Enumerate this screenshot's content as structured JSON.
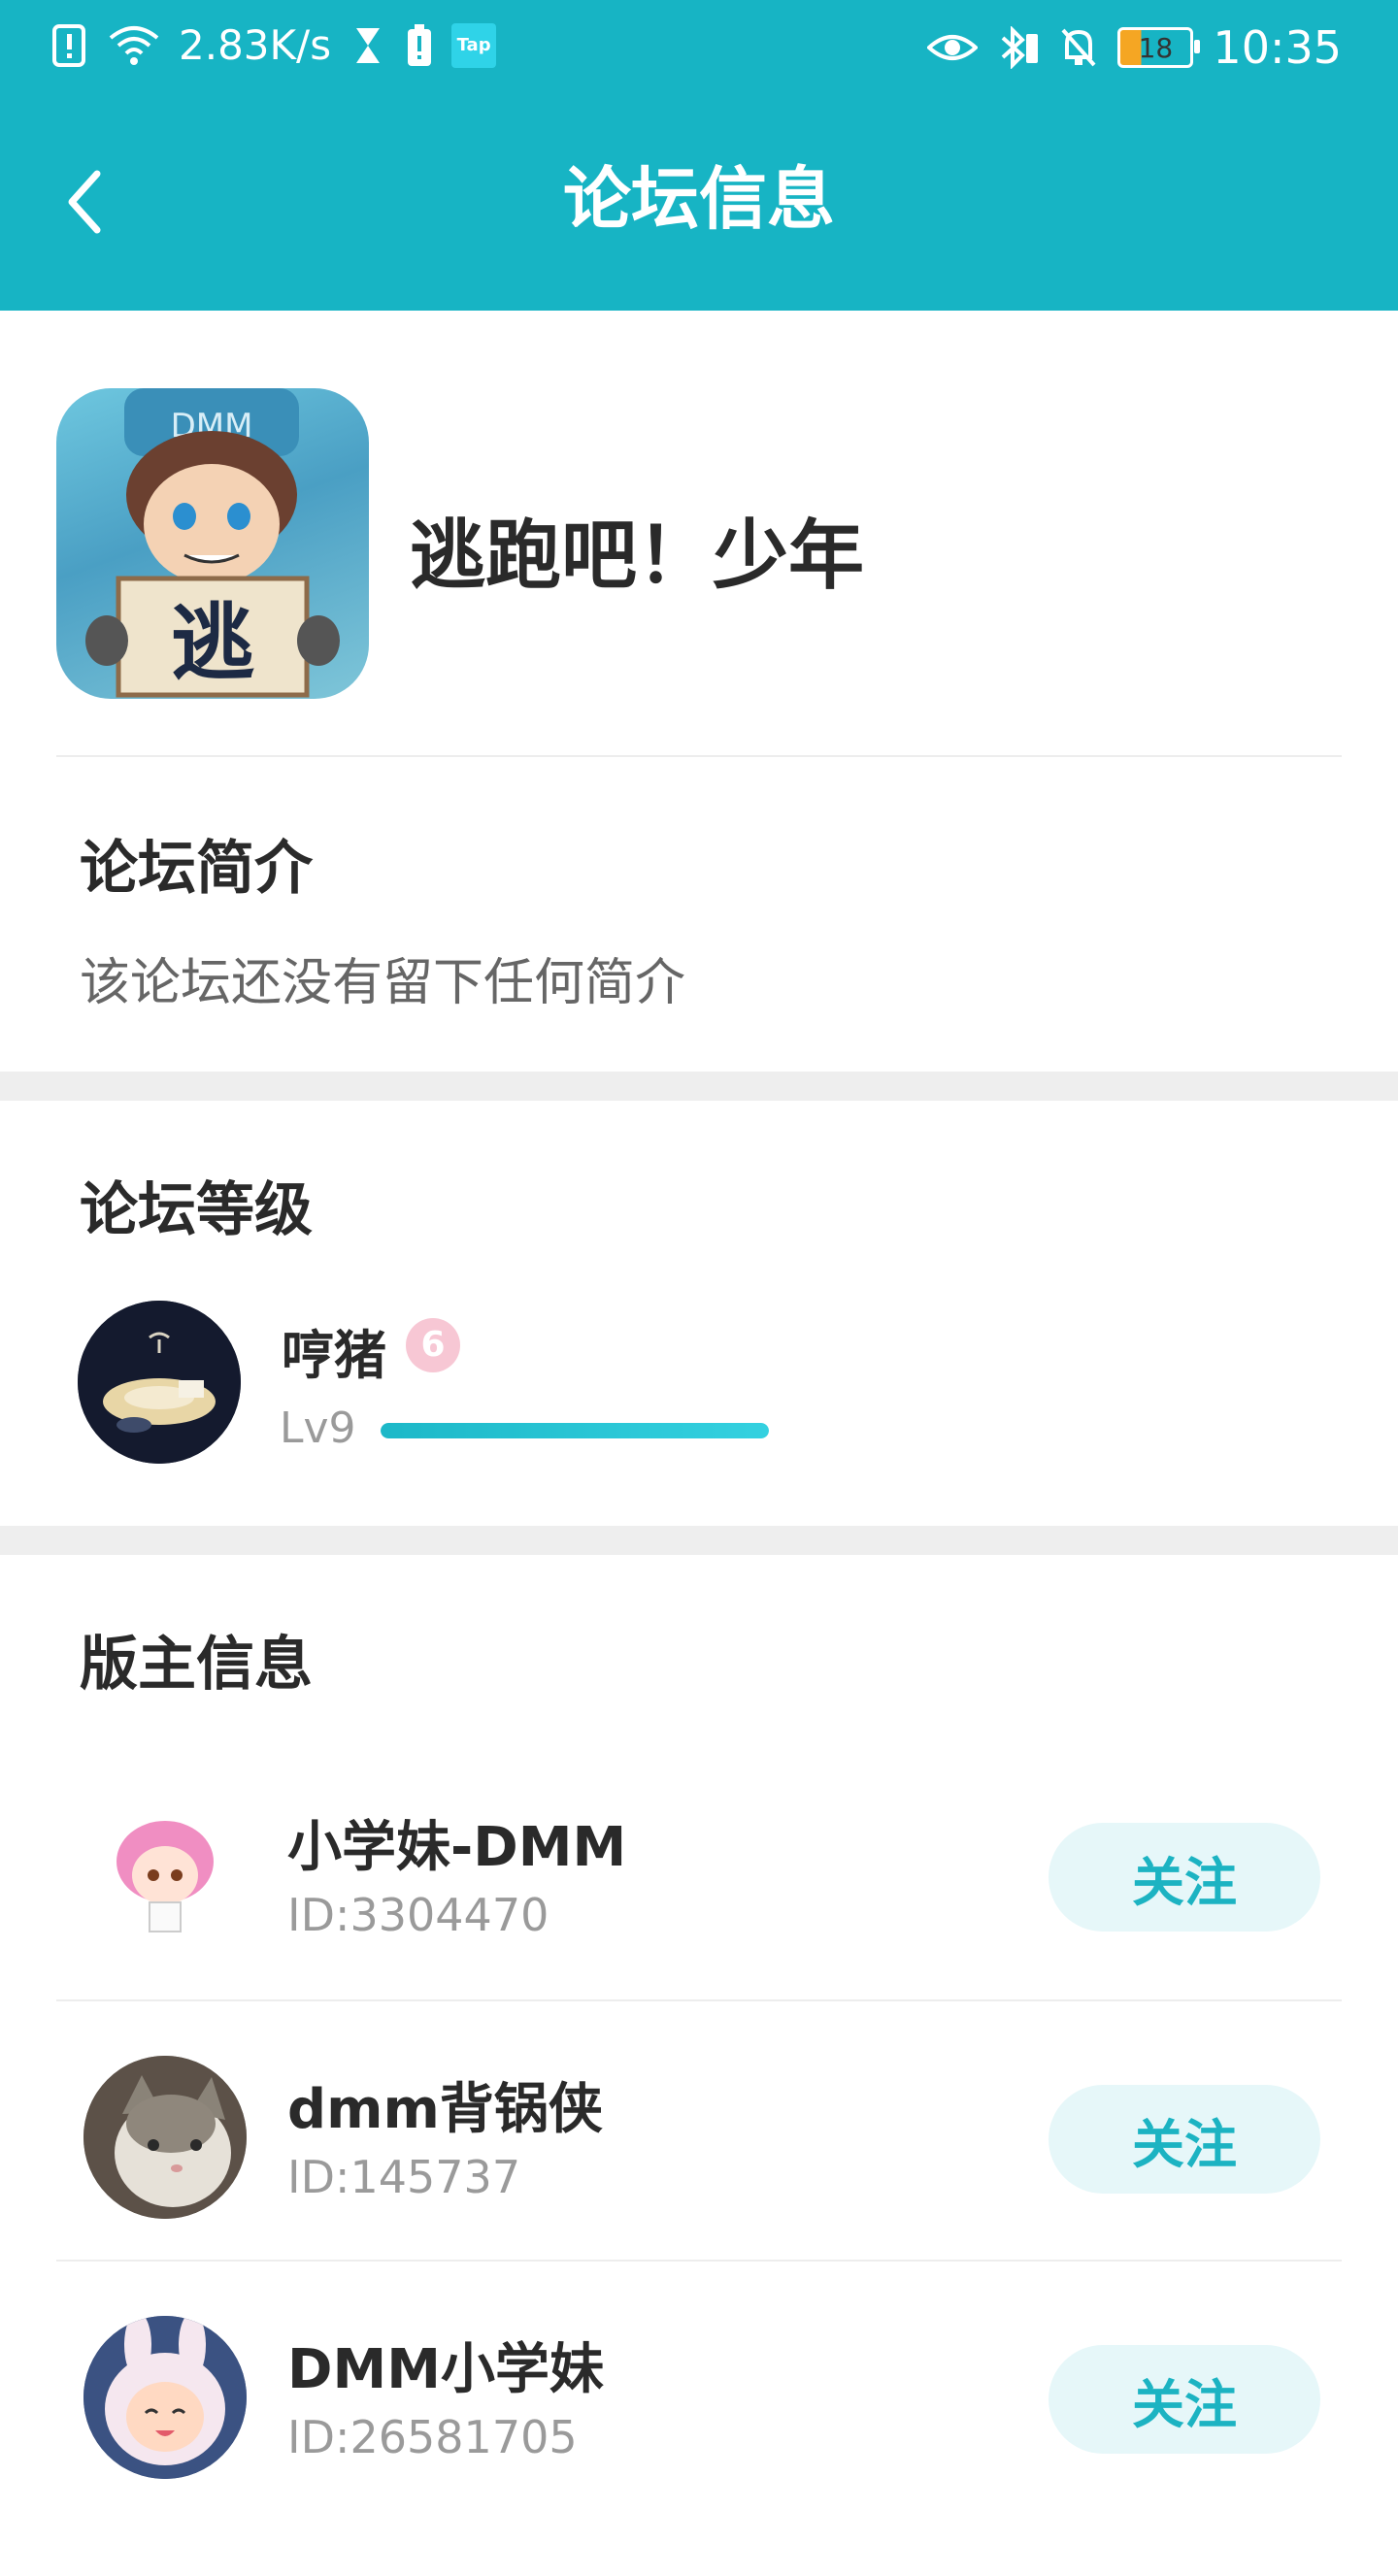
{
  "status_bar": {
    "network_speed": "2.83K/s",
    "tap_badge": "Tap",
    "battery_level": "18",
    "time": "10:35"
  },
  "app_bar": {
    "title": "论坛信息"
  },
  "forum": {
    "name": "逃跑吧！少年",
    "icon_text": "逃",
    "icon_banner": "DMM"
  },
  "intro": {
    "title": "论坛简介",
    "text": "该论坛还没有留下任何简介"
  },
  "level": {
    "title": "论坛等级",
    "name": "哼猪",
    "level_label": "Lv9",
    "badge_text": "6",
    "progress_fraction": 1.0
  },
  "moderators": {
    "title": "版主信息",
    "follow_label": "关注",
    "items": [
      {
        "name": "小学妹-DMM",
        "id": "ID:3304470"
      },
      {
        "name": "dmm背锅侠",
        "id": "ID:145737"
      },
      {
        "name": "DMM小学妹",
        "id": "ID:26581705"
      }
    ]
  },
  "colors": {
    "accent": "#17b4c4",
    "follow_bg": "#e6f7f9",
    "follow_text": "#1cb3c2"
  }
}
